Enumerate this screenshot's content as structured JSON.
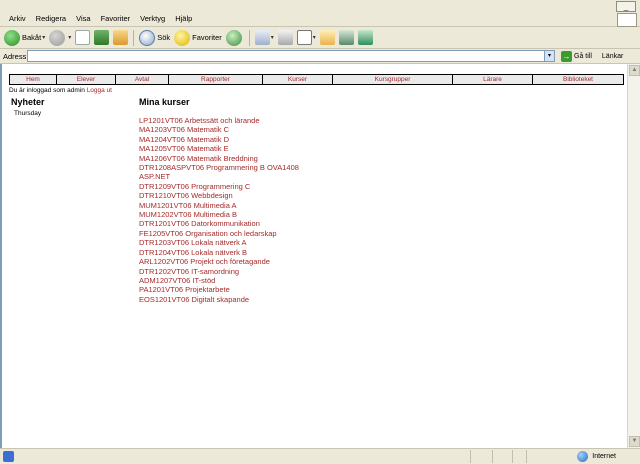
{
  "menu": {
    "items": [
      "Arkiv",
      "Redigera",
      "Visa",
      "Favoriter",
      "Verktyg",
      "Hjälp"
    ]
  },
  "toolbar": {
    "back_label": "Bakåt",
    "search_label": "Sök",
    "favorites_label": "Favoriter"
  },
  "address": {
    "label": "Adress",
    "value": "",
    "go_label": "Gå till",
    "links_label": "Länkar"
  },
  "nav": {
    "items": [
      "Hem",
      "Elever",
      "Avtal",
      "Rapporter",
      "Kurser",
      "Kursgrupper",
      "Lärare",
      "Biblioteket"
    ]
  },
  "login": {
    "text": "Du är inloggad som admin",
    "logout": "Logga ut"
  },
  "news": {
    "title": "Nyheter",
    "day": "Thursday"
  },
  "courses": {
    "title": "Mina kurser",
    "items": [
      "LP1201VT06 Arbetssätt och lärande",
      "MA1203VT06 Matematik C",
      "MA1204VT06 Matematik D",
      "MA1205VT06 Matematik E",
      "MA1206VT06 Matematik Breddning",
      "DTR1208ASPVT06 Programmering B OVA1408",
      "ASP.NET",
      "DTR1209VT06 Programmering C",
      "DTR1210VT06 Webbdesign",
      "MUM1201VT06 Multimedia A",
      "MUM1202VT06 Multimedia B",
      "DTR1201VT06 Datorkommunikation",
      "FE1205VT06 Organisation och ledarskap",
      "DTR1203VT06 Lokala nätverk A",
      "DTR1204VT06 Lokala nätverk B",
      "ARL1202VT06 Projekt och företagande",
      "DTR1202VT06 IT-samordning",
      "ADM1207VT06 IT-stöd",
      "PA1201VT06 Projektarbete",
      "EOS1201VT06 Digitalt skapande"
    ]
  },
  "status": {
    "zone": "Internet"
  },
  "colors": {
    "link": "#a52a2a",
    "chrome": "#ece9d8",
    "nav_bg": "#eaeaea"
  }
}
